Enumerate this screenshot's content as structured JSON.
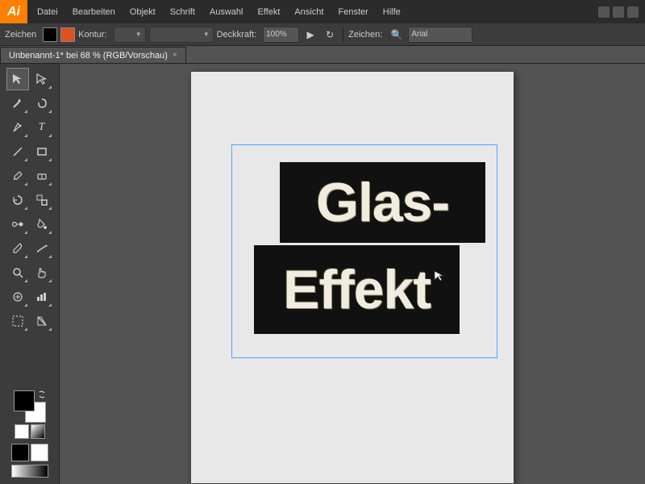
{
  "app": {
    "logo": "Ai",
    "title": "Adobe Illustrator"
  },
  "menu": {
    "items": [
      "Datei",
      "Bearbeiten",
      "Objekt",
      "Schrift",
      "Auswahl",
      "Effekt",
      "Ansicht",
      "Fenster",
      "Hilfe"
    ]
  },
  "toolbar": {
    "zeichen_label": "Zeichen",
    "kontur_label": "Kontur:",
    "deckkkraft_label": "Deckkraft:",
    "deckkraft_value": "100%",
    "zeichen_label2": "Zeichen:",
    "font_value": "Arial"
  },
  "tab": {
    "title": "Unbenannt-1* bei 68 % (RGB/Vorschau)",
    "close": "×"
  },
  "artwork": {
    "line1": "Glas-",
    "line2": "Effekt"
  },
  "tools": [
    "◈",
    "⌖",
    "✎",
    "T",
    "⟋",
    "◻",
    "✏",
    "◎",
    "⧉",
    "◈",
    "✂",
    "◈",
    "⟳",
    "↔",
    "🪣",
    "✦",
    "◈",
    "◈",
    "⊙",
    "▦",
    "◈",
    "◈",
    "⊕",
    "☰"
  ]
}
